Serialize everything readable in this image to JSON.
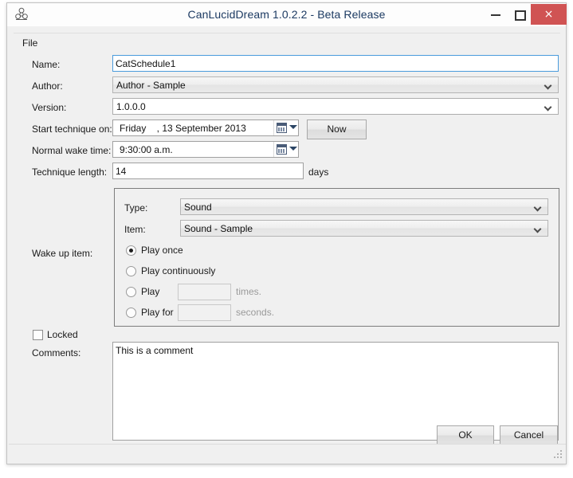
{
  "window": {
    "title": "CanLucidDream 1.0.2.2 - Beta Release",
    "app_icon": "biohazard-icon",
    "minimize_label": "",
    "maximize_label": "",
    "close_label": "×",
    "close_color": "#d05353"
  },
  "menubar": {
    "items": [
      {
        "label": "File"
      }
    ]
  },
  "form": {
    "name": {
      "label": "Name:",
      "value": "CatSchedule1"
    },
    "author": {
      "label": "Author:",
      "value": "Author - Sample"
    },
    "version": {
      "label": "Version:",
      "value": "1.0.0.0"
    },
    "start_on": {
      "label": "Start technique on:",
      "value": "Friday    , 13 September 2013"
    },
    "wake_time": {
      "label": "Normal wake time:",
      "value": "9:30:00 a.m."
    },
    "technique_length": {
      "label": "Technique length:",
      "value": "14",
      "units": "days"
    },
    "now_button": "Now"
  },
  "wake_up_item": {
    "label": "Wake up item:",
    "type": {
      "label": "Type:",
      "value": "Sound"
    },
    "item": {
      "label": "Item:",
      "value": "Sound - Sample"
    },
    "play_modes": [
      {
        "label": "Play once",
        "checked": true
      },
      {
        "label": "Play continuously",
        "checked": false
      },
      {
        "label": "Play",
        "checked": false,
        "value": "",
        "suffix": "times."
      },
      {
        "label": "Play for",
        "checked": false,
        "value": "",
        "suffix": "seconds."
      }
    ]
  },
  "locked": {
    "label": "Locked",
    "checked": false
  },
  "comments": {
    "label": "Comments:",
    "value": "This is a comment"
  },
  "footer": {
    "ok_label": "OK",
    "cancel_label": "Cancel"
  }
}
